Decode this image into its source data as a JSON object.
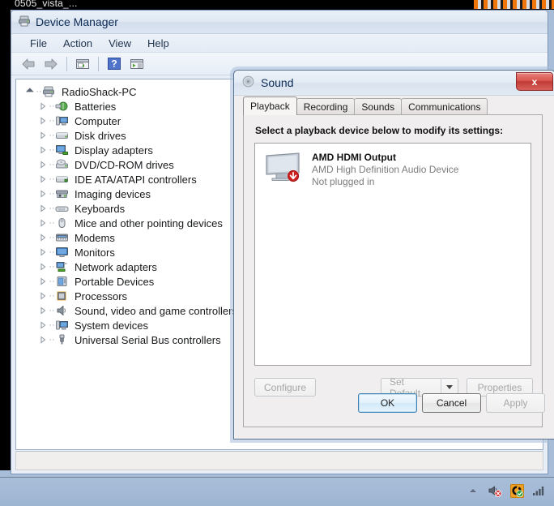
{
  "desktop": {
    "background_text": "0505_vista_...",
    "background_color": "#a8bdd8",
    "accent_blue": "#3c7fb1"
  },
  "device_manager": {
    "title": "Device Manager",
    "icon": "device-manager-icon",
    "menu": [
      "File",
      "Action",
      "View",
      "Help"
    ],
    "toolbar": [
      {
        "name": "back-arrow-icon",
        "label": "Back"
      },
      {
        "name": "forward-arrow-icon",
        "label": "Forward"
      },
      {
        "name": "properties-icon",
        "label": "Properties"
      },
      {
        "name": "help-icon",
        "label": "Help"
      },
      {
        "name": "scan-hardware-icon",
        "label": "Scan for hardware changes"
      }
    ],
    "tree": {
      "root": {
        "label": "RadioShack-PC",
        "icon": "computer-node-icon",
        "expanded": true
      },
      "items": [
        {
          "label": "Batteries",
          "icon": "battery-icon"
        },
        {
          "label": "Computer",
          "icon": "computer-icon"
        },
        {
          "label": "Disk drives",
          "icon": "disk-drive-icon"
        },
        {
          "label": "Display adapters",
          "icon": "display-adapter-icon"
        },
        {
          "label": "DVD/CD-ROM drives",
          "icon": "dvd-drive-icon"
        },
        {
          "label": "IDE ATA/ATAPI controllers",
          "icon": "ide-controller-icon"
        },
        {
          "label": "Imaging devices",
          "icon": "imaging-device-icon"
        },
        {
          "label": "Keyboards",
          "icon": "keyboard-icon"
        },
        {
          "label": "Mice and other pointing devices",
          "icon": "mouse-icon"
        },
        {
          "label": "Modems",
          "icon": "modem-icon"
        },
        {
          "label": "Monitors",
          "icon": "monitor-icon"
        },
        {
          "label": "Network adapters",
          "icon": "network-adapter-icon"
        },
        {
          "label": "Portable Devices",
          "icon": "portable-device-icon"
        },
        {
          "label": "Processors",
          "icon": "processor-icon"
        },
        {
          "label": "Sound, video and game controllers",
          "icon": "speaker-icon"
        },
        {
          "label": "System devices",
          "icon": "system-device-icon"
        },
        {
          "label": "Universal Serial Bus controllers",
          "icon": "usb-icon"
        }
      ]
    }
  },
  "sound_dialog": {
    "title": "Sound",
    "icon": "sound-speaker-icon",
    "close_label": "x",
    "tabs": [
      {
        "label": "Playback",
        "active": true
      },
      {
        "label": "Recording",
        "active": false
      },
      {
        "label": "Sounds",
        "active": false
      },
      {
        "label": "Communications",
        "active": false
      }
    ],
    "panel_instruction": "Select a playback device below to modify its settings:",
    "devices": [
      {
        "name": "AMD HDMI Output",
        "driver": "AMD High Definition Audio Device",
        "status": "Not plugged in",
        "icon": "hdmi-monitor-icon",
        "badge": "not-plugged-in-badge"
      }
    ],
    "panel_buttons": {
      "configure": {
        "label": "Configure",
        "disabled": true
      },
      "set_default": {
        "label": "Set Default",
        "disabled": true,
        "has_dropdown": true
      },
      "properties": {
        "label": "Properties",
        "disabled": true
      }
    },
    "footer_buttons": {
      "ok": {
        "label": "OK",
        "default": true,
        "disabled": false
      },
      "cancel": {
        "label": "Cancel",
        "default": false,
        "disabled": false
      },
      "apply": {
        "label": "Apply",
        "default": false,
        "disabled": true
      }
    }
  },
  "taskbar": {
    "tray": [
      {
        "name": "show-hidden-icons-icon",
        "label": "Show hidden icons"
      },
      {
        "name": "volume-muted-icon",
        "label": "Volume muted"
      },
      {
        "name": "antivirus-shield-icon",
        "label": "Antivirus"
      },
      {
        "name": "network-signal-icon",
        "label": "Network"
      }
    ]
  }
}
